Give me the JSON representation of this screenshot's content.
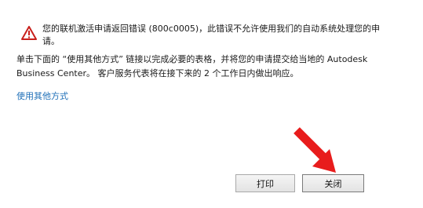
{
  "dialog": {
    "error_line_1": "您的联机激活申请返回错误 (800c0005)，此错误不允许使用我们的自动系统处理您的申",
    "error_line_2": "请。",
    "body_line_1": "单击下面的 “使用其他方式” 链接以完成必要的表格，并将您的申请提交给当地的 Autodesk",
    "body_line_2": "Business Center。 客户服务代表将在接下来的 2 个工作日内做出响应。",
    "alt_link": "使用其他方式",
    "print_label": "打印",
    "close_label": "关闭"
  },
  "icons": {
    "warning": "warning-icon",
    "arrow": "red-arrow-annotation"
  },
  "colors": {
    "warning_red": "#c8201c",
    "link_blue": "#1e6fb8",
    "arrow_red": "#e81c1c"
  }
}
